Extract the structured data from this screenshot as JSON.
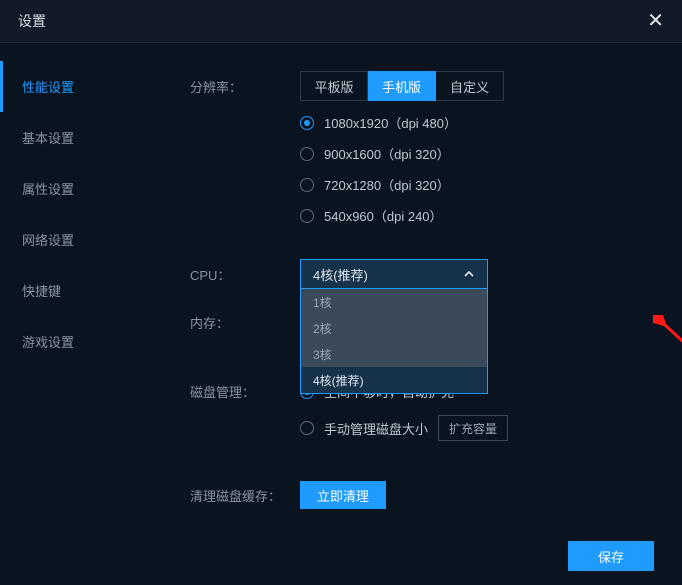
{
  "titlebar": {
    "title": "设置"
  },
  "sidebar": {
    "items": [
      {
        "label": "性能设置",
        "active": true
      },
      {
        "label": "基本设置"
      },
      {
        "label": "属性设置"
      },
      {
        "label": "网络设置"
      },
      {
        "label": "快捷键"
      },
      {
        "label": "游戏设置"
      }
    ]
  },
  "resolution": {
    "label": "分辨率：",
    "tabs": [
      {
        "label": "平板版"
      },
      {
        "label": "手机版",
        "active": true
      },
      {
        "label": "自定义"
      }
    ],
    "options": [
      {
        "label": "1080x1920（dpi 480）",
        "selected": true
      },
      {
        "label": "900x1600（dpi 320）"
      },
      {
        "label": "720x1280（dpi 320）"
      },
      {
        "label": "540x960（dpi 240）"
      }
    ]
  },
  "cpu": {
    "label": "CPU：",
    "selected": "4核(推荐)",
    "options": [
      "1核",
      "2核",
      "3核",
      "4核(推荐)"
    ]
  },
  "memory": {
    "label": "内存："
  },
  "disk": {
    "label": "磁盘管理：",
    "auto_expand": "空间不够时，自动扩充",
    "manual": "手动管理磁盘大小",
    "expand_btn": "扩充容量"
  },
  "clean": {
    "label": "清理磁盘缓存：",
    "btn": "立即清理"
  },
  "save_btn": "保存"
}
